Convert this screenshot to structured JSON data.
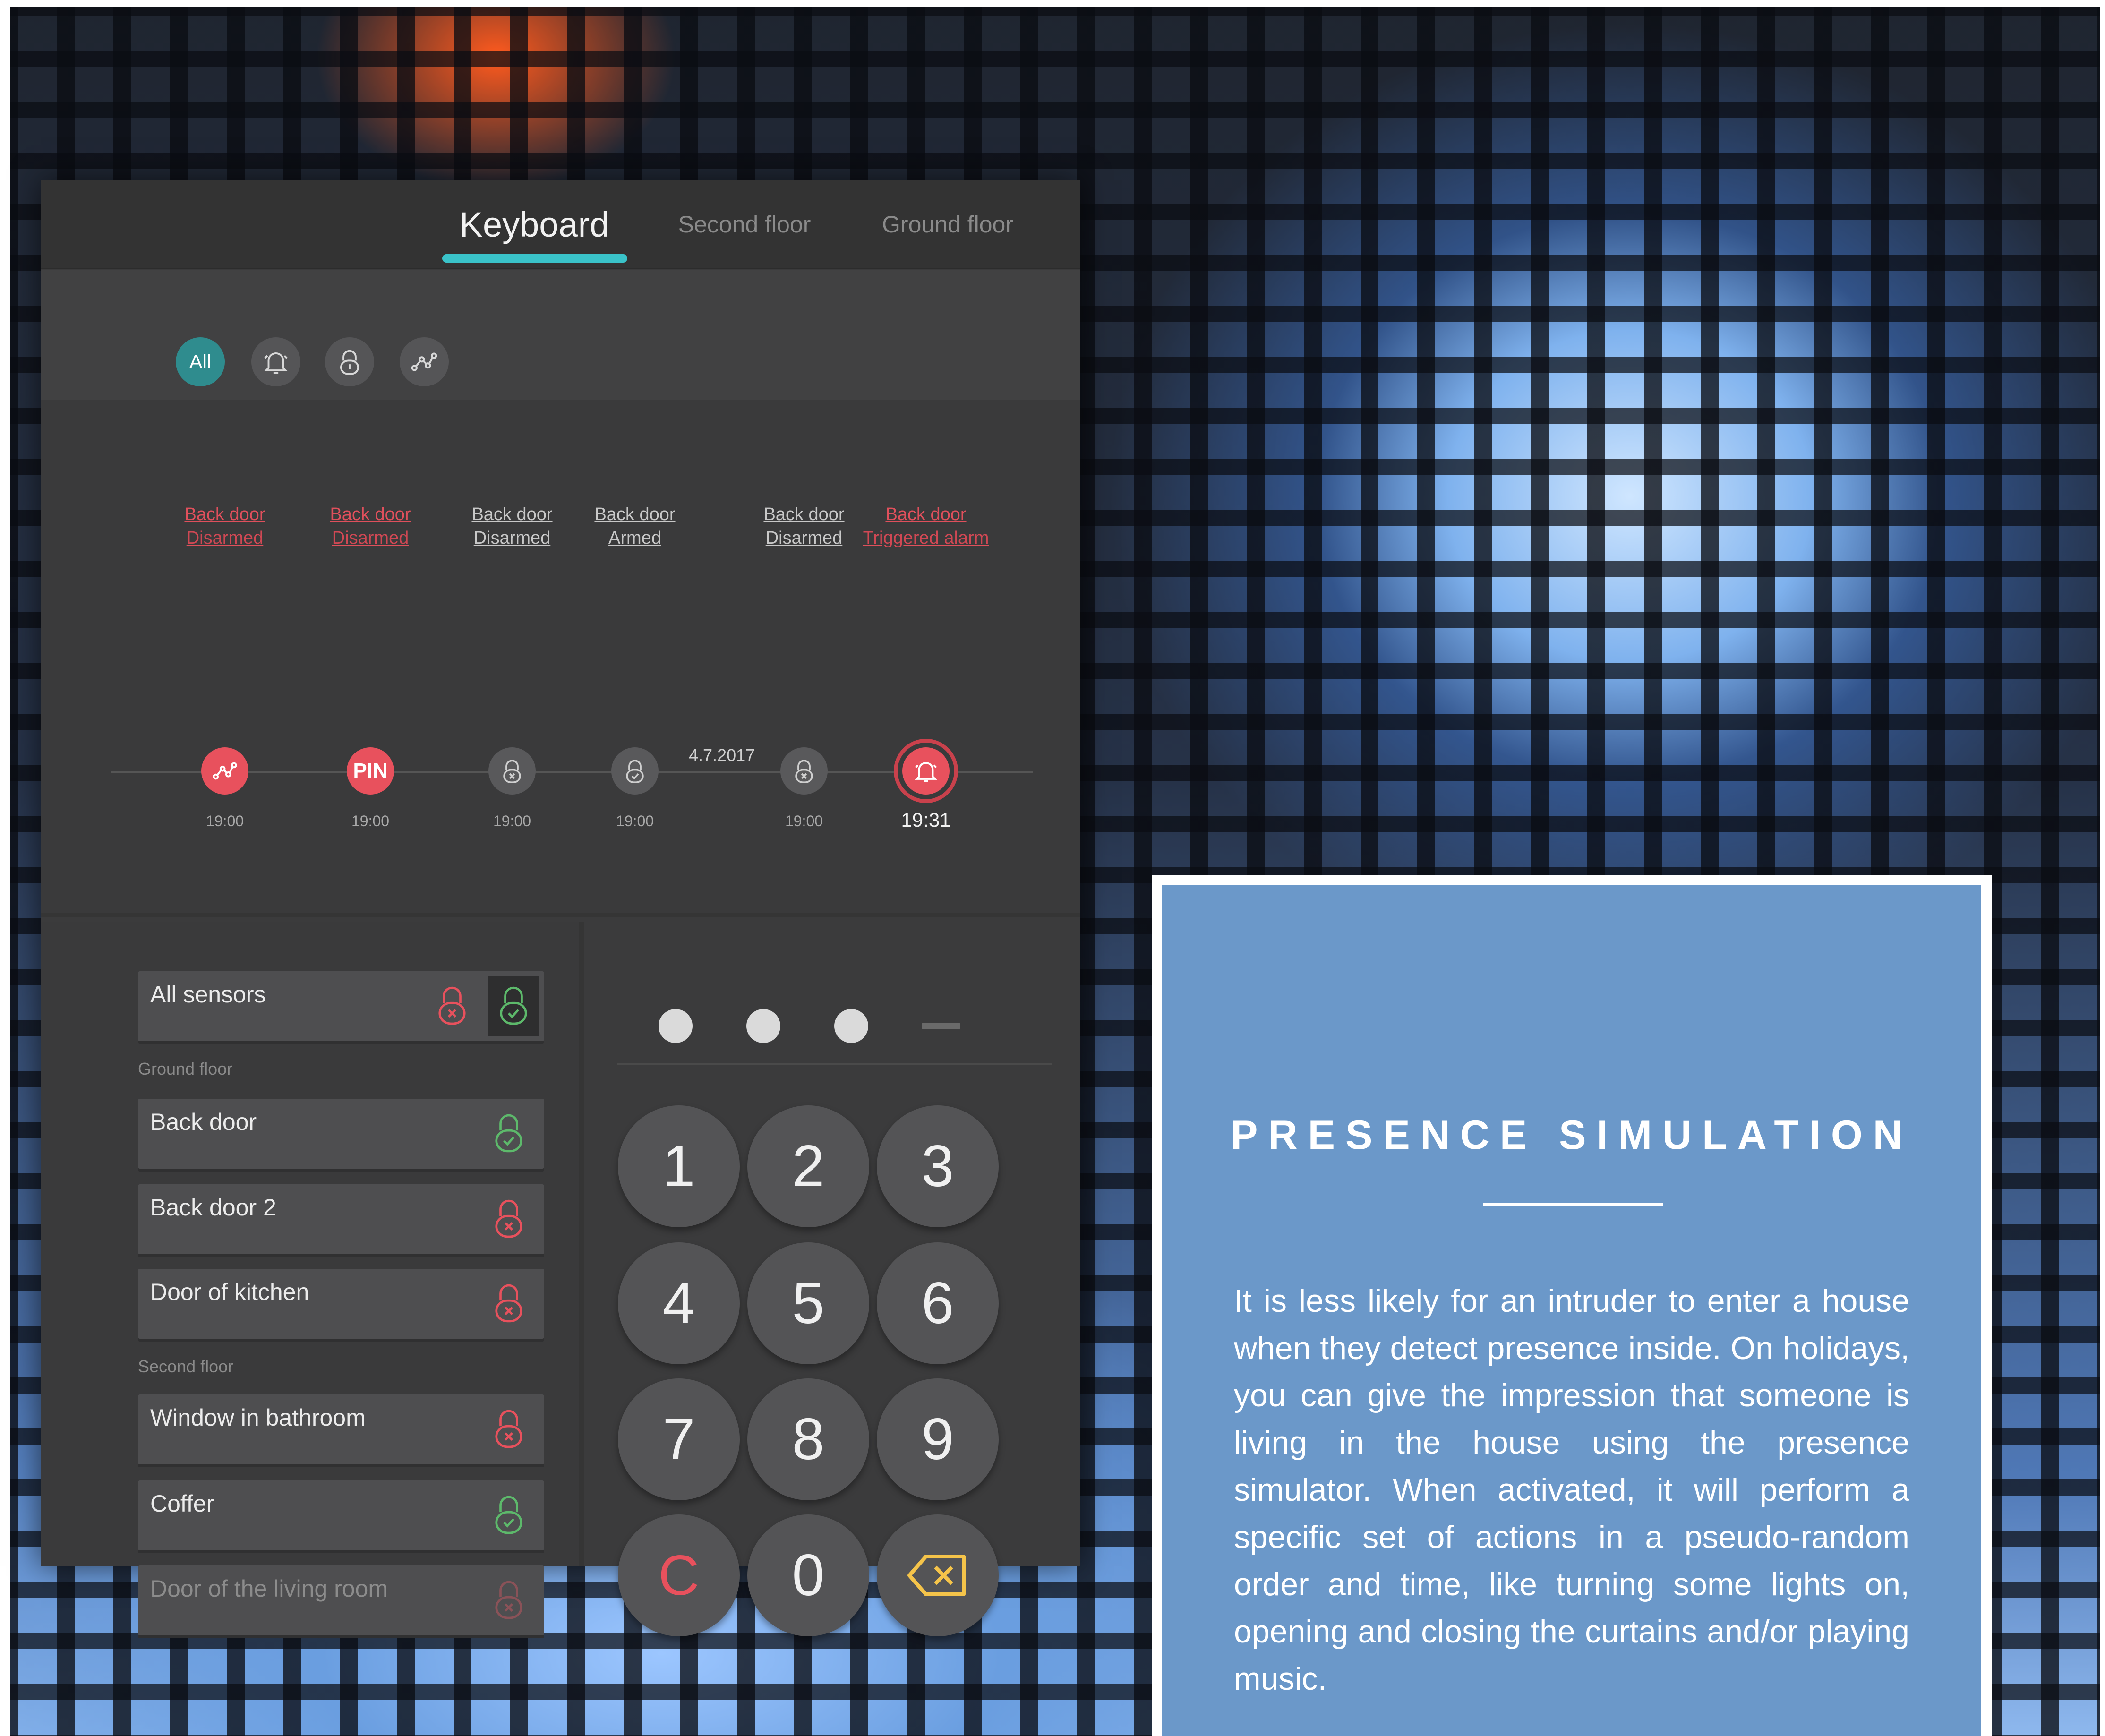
{
  "tabs": [
    "Keyboard",
    "Second floor",
    "Ground floor"
  ],
  "filters": {
    "all_label": "All",
    "icons": [
      "bell-icon",
      "lock-icon",
      "chart-icon"
    ]
  },
  "timeline": {
    "date": "4.7.2017",
    "events": [
      {
        "device": "Back door",
        "status": "Disarmed",
        "time": "19:00",
        "icon": "chart-icon",
        "tone": "red"
      },
      {
        "device": "Back door",
        "status": "Disarmed",
        "time": "19:00",
        "icon": "pin-badge",
        "badge": "PIN",
        "tone": "red"
      },
      {
        "device": "Back door",
        "status": "Disarmed",
        "time": "19:00",
        "icon": "unlock-icon",
        "tone": "grey"
      },
      {
        "device": "Back door",
        "status": "Armed",
        "time": "19:00",
        "icon": "lock-icon",
        "tone": "grey"
      },
      {
        "device": "Back door",
        "status": "Disarmed",
        "time": "19:00",
        "icon": "unlock-icon",
        "tone": "grey"
      },
      {
        "device": "Back door",
        "status": "Triggered alarm",
        "time": "19:31",
        "icon": "bell-icon",
        "tone": "alarm"
      }
    ]
  },
  "sensors": {
    "all_label": "All sensors",
    "groups": [
      {
        "label": "Ground floor",
        "items": [
          {
            "name": "Back door",
            "state": "armed"
          },
          {
            "name": "Back door 2",
            "state": "disarmed"
          },
          {
            "name": "Door of kitchen",
            "state": "disarmed"
          }
        ]
      },
      {
        "label": "Second floor",
        "items": [
          {
            "name": "Window in bathroom",
            "state": "disarmed"
          },
          {
            "name": "Coffer",
            "state": "armed"
          },
          {
            "name": "Door of the living room",
            "state": "disabled"
          }
        ]
      }
    ]
  },
  "keypad": {
    "pin_entered": 3,
    "keys": [
      "1",
      "2",
      "3",
      "4",
      "5",
      "6",
      "7",
      "8",
      "9",
      "C",
      "0"
    ],
    "backspace_icon": "backspace-icon"
  },
  "colors": {
    "accent": "#3ac3c9",
    "alarm": "#e8515d",
    "armed": "#5db96b",
    "panel": "#3b3b3c",
    "card": "#6b98c9"
  },
  "card": {
    "title": "PRESENCE SIMULATION",
    "body": "It is less likely for an intruder to enter a house when they detect presence inside. On holidays, you can give the impression that someone is living in the house using the presence simulator. When activated, it will perform a specific set of actions in a pseudo-random order and time, like turning some lights on, opening and closing the curtains and/or playing music."
  }
}
